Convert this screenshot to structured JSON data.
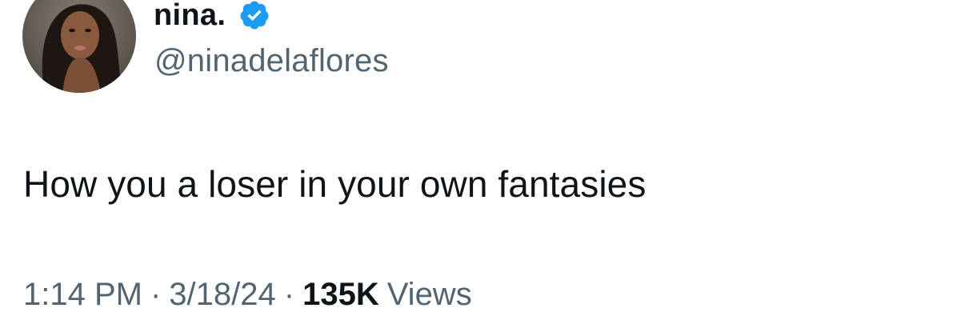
{
  "author": {
    "display_name": "nina.",
    "handle": "@ninadelaflores",
    "verified": true,
    "verified_color": "#1d9bf0",
    "avatar_icon": "profile-photo"
  },
  "tweet": {
    "text": "How you a loser in your own fantasies"
  },
  "meta": {
    "time": "1:14 PM",
    "separator": "·",
    "date": "3/18/24",
    "views_count": "135K",
    "views_label": "Views"
  }
}
